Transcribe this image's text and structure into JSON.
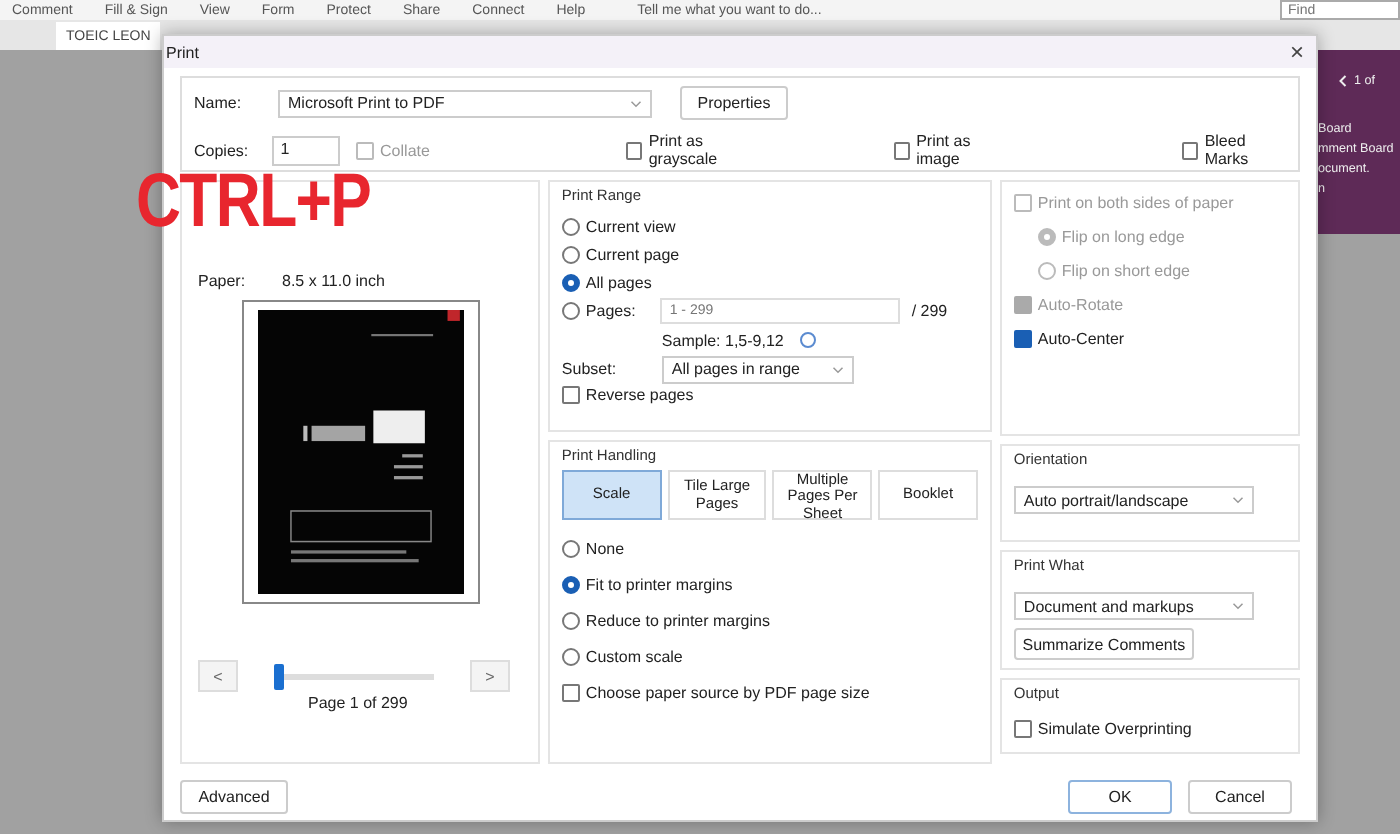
{
  "app": {
    "menu": [
      "Comment",
      "Fill & Sign",
      "View",
      "Form",
      "Protect",
      "Share",
      "Connect",
      "Help"
    ],
    "tell_me": "Tell me what you want to do...",
    "find": {
      "placeholder": "Find"
    },
    "tab": {
      "label": "TOEIC LEON"
    },
    "side_panel": {
      "pager": "1 of",
      "lines": [
        "Board",
        "mment Board",
        "ocument.",
        "n"
      ]
    }
  },
  "overlay": {
    "label": "CTRL+P"
  },
  "dialog": {
    "title": "Print",
    "close": "×",
    "printer": {
      "label": "Name:",
      "value": "Microsoft Print to PDF",
      "properties": "Properties"
    },
    "copies": {
      "label": "Copies:",
      "value": "1",
      "collate": {
        "label": "Collate",
        "checked": false,
        "disabled": true
      }
    },
    "top_options": [
      {
        "label": "Print as grayscale",
        "checked": false
      },
      {
        "label": "Print as image",
        "checked": false
      },
      {
        "label": "Bleed Marks",
        "checked": false
      }
    ],
    "preview": {
      "rows": [
        {
          "label": "Paper:",
          "value": [
            "8.5 x 11.0 inch"
          ]
        }
      ],
      "page_label": "Page 1 of 299",
      "slider": {
        "level": 0.0
      },
      "prev": "<",
      "next": ">"
    },
    "print_range": {
      "title": "Print Range",
      "options": [
        {
          "label": "Current view",
          "selected": false
        },
        {
          "label": "Current page",
          "selected": false
        },
        {
          "label": "All pages",
          "selected": true
        },
        {
          "label": "Pages:",
          "selected": false
        }
      ],
      "pages_placeholder": "1 - 299",
      "pages_total": "/ 299",
      "sample": "Sample: 1,5-9,12",
      "subset_label": "Subset:",
      "subset": "All pages in range",
      "reverse": {
        "label": "Reverse pages",
        "checked": false
      }
    },
    "print_handling": {
      "title": "Print Handling",
      "tabs": [
        {
          "label": "Scale",
          "selected": true
        },
        {
          "label": "Tile Large Pages",
          "selected": false
        },
        {
          "label": "Multiple Pages Per Sheet",
          "selected": false
        },
        {
          "label": "Booklet",
          "selected": false
        }
      ],
      "options": [
        {
          "label": "None",
          "selected": false
        },
        {
          "label": "Fit to printer margins",
          "selected": true
        },
        {
          "label": "Reduce to printer margins",
          "selected": false
        },
        {
          "label": "Custom scale",
          "selected": false
        }
      ],
      "paper_source": {
        "label": "Choose paper source by PDF page size",
        "checked": false
      }
    },
    "duplex": [
      {
        "kind": "checkbox",
        "label": "Print on both sides of paper",
        "checked": false,
        "disabled": true
      },
      {
        "kind": "radio",
        "label": "Flip on long edge",
        "selected": true,
        "disabled": true
      },
      {
        "kind": "radio",
        "label": "Flip on short edge",
        "selected": false,
        "disabled": true
      },
      {
        "kind": "checkbox",
        "label": "Auto-Rotate",
        "checked": true,
        "disabled": true
      },
      {
        "kind": "checkbox",
        "label": "Auto-Center",
        "checked": true,
        "disabled": false
      }
    ],
    "orientation": {
      "title": "Orientation",
      "value": "Auto portrait/landscape"
    },
    "print_what": {
      "title": "Print What",
      "value": "Document and markups",
      "summarize": "Summarize Comments"
    },
    "output": {
      "title": "Output",
      "simulate": {
        "label": "Simulate Overprinting",
        "checked": false
      }
    },
    "buttons": {
      "advanced": "Advanced",
      "ok": "OK",
      "cancel": "Cancel"
    }
  }
}
